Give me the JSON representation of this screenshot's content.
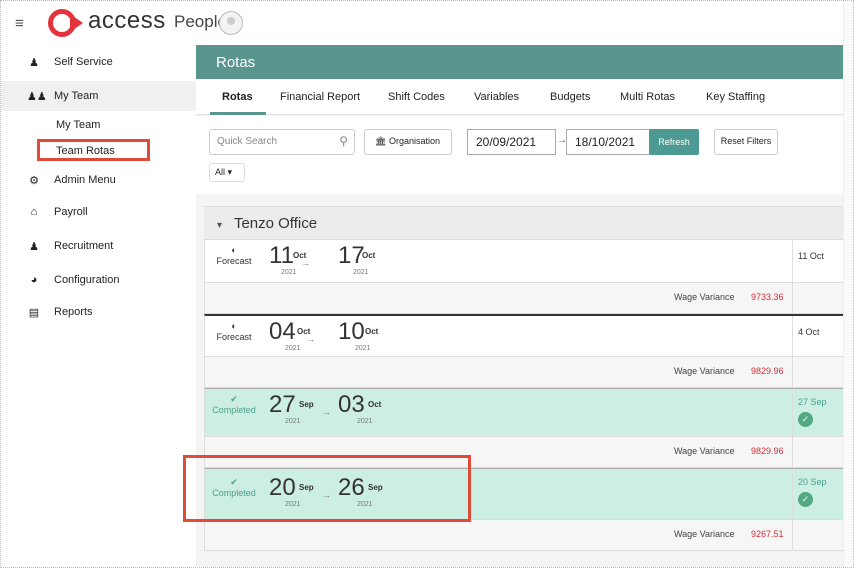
{
  "app": {
    "brand": "access",
    "product": "People"
  },
  "sidebar": {
    "items": [
      {
        "label": "Self Service",
        "icon": "person-icon"
      },
      {
        "label": "My Team",
        "icon": "team-icon"
      },
      {
        "label": "Admin Menu",
        "icon": "gears-icon"
      },
      {
        "label": "Payroll",
        "icon": "home-icon"
      },
      {
        "label": "Recruitment",
        "icon": "person-icon"
      },
      {
        "label": "Configuration",
        "icon": "globe-icon"
      },
      {
        "label": "Reports",
        "icon": "report-icon"
      }
    ],
    "sub_items": [
      "My Team",
      "Team Rotas"
    ]
  },
  "header": {
    "title": "Rotas"
  },
  "tabs": [
    "Rotas",
    "Financial Report",
    "Shift Codes",
    "Variables",
    "Budgets",
    "Multi Rotas",
    "Key Staffing"
  ],
  "filters": {
    "search_placeholder": "Quick Search",
    "organisation_label": "Organisation",
    "date_from": "20/09/2021",
    "date_to": "18/10/2021",
    "refresh_label": "Refresh",
    "reset_label": "Reset Filters",
    "all_chip": "All"
  },
  "group": {
    "name": "Tenzo Office"
  },
  "rotas": [
    {
      "status": "Forecast",
      "start_day": "11",
      "start_month": "Oct",
      "start_year": "2021",
      "end_day": "17",
      "end_month": "Oct",
      "end_year": "2021",
      "side": "11 Oct",
      "wage_label": "Wage Variance",
      "wage_value": "9733.36"
    },
    {
      "status": "Forecast",
      "start_day": "04",
      "start_month": "Oct",
      "start_year": "2021",
      "end_day": "10",
      "end_month": "Oct",
      "end_year": "2021",
      "side": "4 Oct",
      "wage_label": "Wage Variance",
      "wage_value": "9829.96"
    },
    {
      "status": "Completed",
      "start_day": "27",
      "start_month": "Sep",
      "start_year": "2021",
      "end_day": "03",
      "end_month": "Oct",
      "end_year": "2021",
      "side": "27 Sep",
      "wage_label": "Wage Variance",
      "wage_value": "9829.96"
    },
    {
      "status": "Completed",
      "start_day": "20",
      "start_month": "Sep",
      "start_year": "2021",
      "end_day": "26",
      "end_month": "Sep",
      "end_year": "2021",
      "side": "20 Sep",
      "wage_label": "Wage Variance",
      "wage_value": "9267.51"
    }
  ],
  "colors": {
    "brand_red": "#e5333c",
    "header_teal": "#5a9590",
    "refresh_teal": "#4c9a93",
    "completed_bg": "#cdeee3",
    "wage_red": "#d0323a",
    "highlight_box": "#e04b39"
  }
}
